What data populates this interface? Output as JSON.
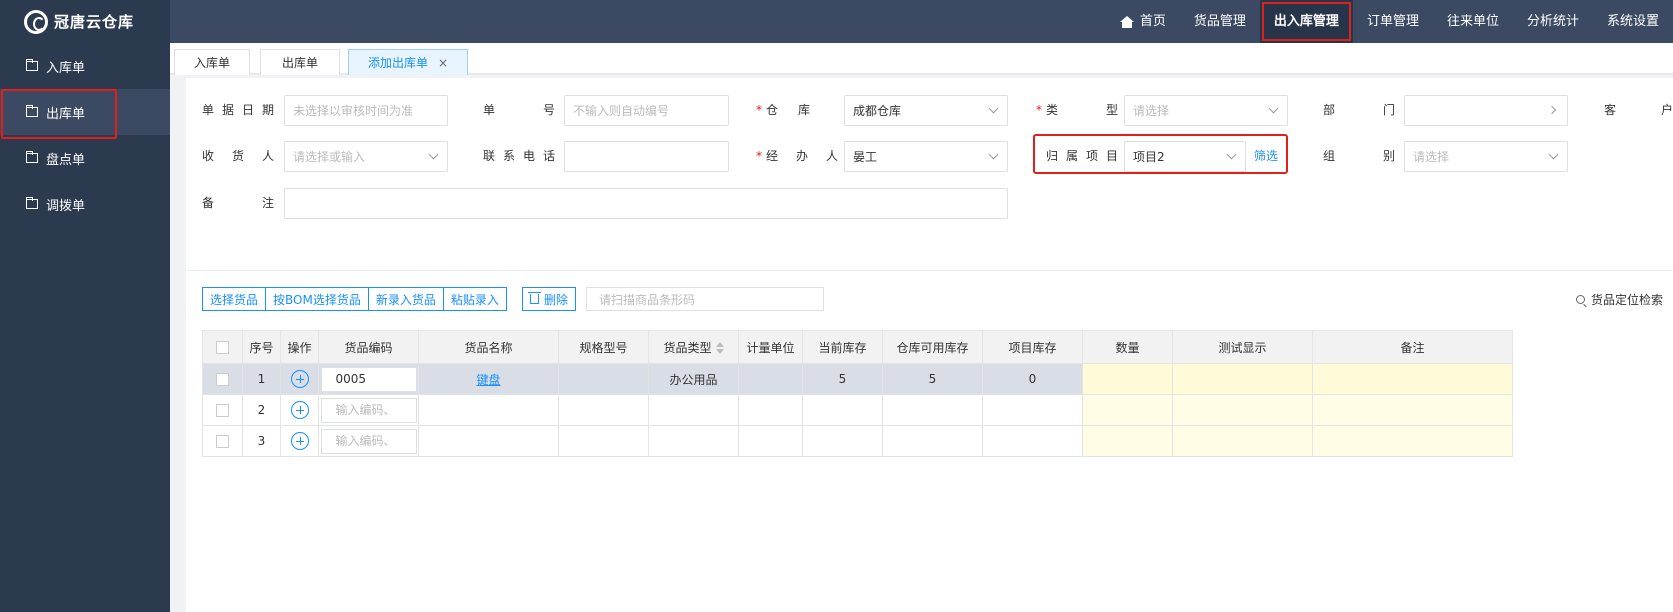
{
  "app": {
    "name": "冠唐云仓库"
  },
  "nav": {
    "items": [
      {
        "label": "首页"
      },
      {
        "label": "货品管理"
      },
      {
        "label": "出入库管理"
      },
      {
        "label": "订单管理"
      },
      {
        "label": "往来单位"
      },
      {
        "label": "分析统计"
      },
      {
        "label": "系统设置"
      }
    ],
    "active": "出入库管理"
  },
  "sidebar": {
    "items": [
      {
        "label": "入库单"
      },
      {
        "label": "出库单"
      },
      {
        "label": "盘点单"
      },
      {
        "label": "调拨单"
      }
    ],
    "active": "出库单"
  },
  "tabs": [
    {
      "label": "入库单"
    },
    {
      "label": "出库单"
    },
    {
      "label": "添加出库单",
      "close": "×"
    }
  ],
  "form": {
    "date": {
      "label": "单据日期",
      "placeholder": "未选择以审核时间为准"
    },
    "number": {
      "label": "单号",
      "placeholder": "不输入则自动编号"
    },
    "warehouse": {
      "label": "仓库",
      "value": "成都仓库",
      "required": "*"
    },
    "type": {
      "label": "类型",
      "placeholder": "请选择",
      "required": "*"
    },
    "department": {
      "label": "部门",
      "value": ""
    },
    "customer": {
      "label": "客户"
    },
    "receiver": {
      "label": "收货人",
      "placeholder": "请选择或输入"
    },
    "phone": {
      "label": "联系电话",
      "value": ""
    },
    "handler": {
      "label": "经办人",
      "value": "晏工",
      "required": "*"
    },
    "project": {
      "label": "归属项目",
      "value": "项目2",
      "filter": "筛选"
    },
    "group": {
      "label": "组别",
      "placeholder": "请选择"
    },
    "remark": {
      "label": "备注",
      "value": ""
    }
  },
  "toolbar": {
    "buttons": [
      "选择货品",
      "按BOM选择货品",
      "新录入货品",
      "粘贴录入"
    ],
    "delete": "删除",
    "scan_placeholder": "请扫描商品条形码",
    "locate": "货品定位检索"
  },
  "table": {
    "headers": [
      "序号",
      "操作",
      "货品编码",
      "货品名称",
      "规格型号",
      "货品类型",
      "计量单位",
      "当前库存",
      "仓库可用库存",
      "项目库存",
      "数量",
      "测试显示",
      "备注"
    ],
    "rows": [
      {
        "seq": "1",
        "code": "0005",
        "name": "键盘",
        "spec": "",
        "type": "办公用品",
        "unit": "",
        "stock": "5",
        "available": "5",
        "project_stock": "0"
      },
      {
        "seq": "2",
        "code_placeholder": "输入编码、"
      },
      {
        "seq": "3",
        "code_placeholder": "输入编码、"
      }
    ]
  }
}
